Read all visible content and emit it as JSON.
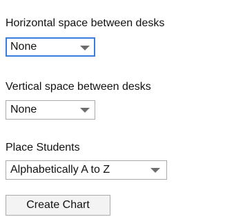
{
  "horizontal": {
    "label": "Horizontal space between desks",
    "selected": "None"
  },
  "vertical": {
    "label": "Vertical space between desks",
    "selected": "None"
  },
  "placement": {
    "label": "Place Students",
    "selected": "Alphabetically A to Z"
  },
  "actions": {
    "create_chart_label": "Create Chart"
  }
}
